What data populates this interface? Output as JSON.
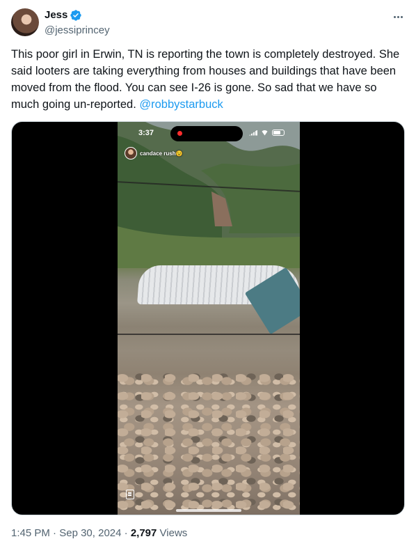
{
  "author": {
    "display_name": "Jess",
    "handle": "@jessiprincey",
    "verified": true,
    "verified_color": "#1d9bf0"
  },
  "tweet": {
    "text": "This poor girl in Erwin, TN is reporting the town is completely destroyed. She said looters are taking everything from houses and buildings that have been moved from the flood. You can see I-26 is gone. So sad that we have so much going un-reported. ",
    "mention": "@robbystarbuck",
    "mention_color": "#1d9bf0"
  },
  "video": {
    "status_time": "3:37",
    "live_chip_label": "candace rush😉",
    "icons": [
      "record-dot-icon",
      "signal-icon",
      "wifi-icon",
      "battery-icon",
      "note-icon"
    ]
  },
  "meta": {
    "time": "1:45 PM",
    "date": "Sep 30, 2024",
    "views_count": "2,797",
    "views_label": "Views",
    "separator": "·"
  },
  "icons": {
    "more": "more-options-icon",
    "verified": "verified-badge-icon"
  }
}
